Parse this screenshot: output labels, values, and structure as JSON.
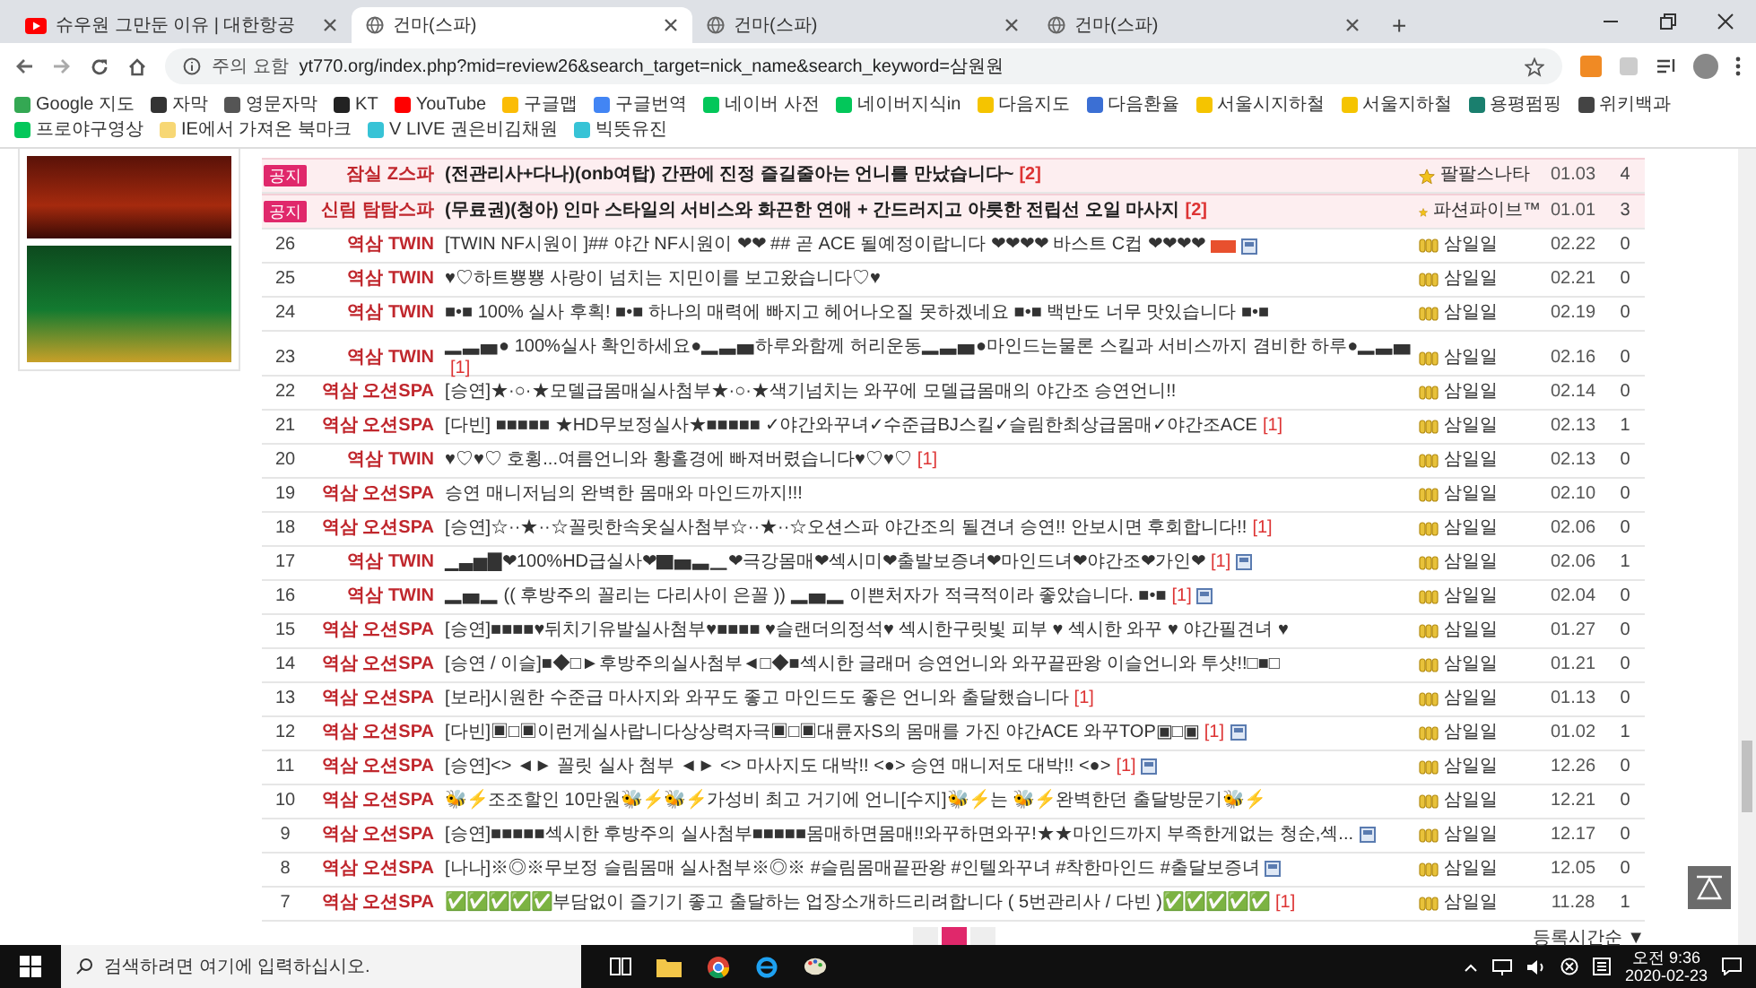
{
  "browser": {
    "tabs": [
      {
        "title": "슈우원 그만둔 이유 | 대한항공",
        "kind": "video",
        "selected": false
      },
      {
        "title": "건마(스파)",
        "kind": "page",
        "selected": true
      },
      {
        "title": "건마(스파)",
        "kind": "page",
        "selected": false
      },
      {
        "title": "건마(스파)",
        "kind": "page",
        "selected": false
      }
    ],
    "new_tab": "+",
    "security_label": "주의 요함",
    "url": "yt770.org/index.php?mid=review26&search_target=nick_name&search_keyword=삼원원",
    "bookmarks": [
      {
        "label": "Google 지도",
        "color": "#34a853"
      },
      {
        "label": "자막",
        "color": "#333333"
      },
      {
        "label": "영문자막",
        "color": "#555555"
      },
      {
        "label": "KT",
        "color": "#222222"
      },
      {
        "label": "YouTube",
        "color": "#ff0000"
      },
      {
        "label": "구글맵",
        "color": "#fbbc05"
      },
      {
        "label": "구글번역",
        "color": "#4285f4"
      },
      {
        "label": "네이버 사전",
        "color": "#03c75a"
      },
      {
        "label": "네이버지식in",
        "color": "#03c75a"
      },
      {
        "label": "다음지도",
        "color": "#f5c400"
      },
      {
        "label": "다음환율",
        "color": "#3b6fd4"
      },
      {
        "label": "서울시지하철",
        "color": "#f5c400"
      },
      {
        "label": "서울지하철",
        "color": "#f5c400"
      },
      {
        "label": "용평펌핑",
        "color": "#1a7f6e"
      },
      {
        "label": "위키백과",
        "color": "#444444"
      },
      {
        "label": "프로야구영상",
        "color": "#03c75a"
      },
      {
        "label": "IE에서 가져온 북마크",
        "color": "#f7d774"
      },
      {
        "label": "V LIVE 권은비김채원",
        "color": "#37c3d6"
      },
      {
        "label": "빅뜻유진",
        "color": "#37c3d6"
      }
    ]
  },
  "board": {
    "rows": [
      {
        "kind": "notice",
        "badge": "공지",
        "category": "잠실 Z스파",
        "title": "(전관리사+다나)(onb여탑) 간판에 진정 즐길줄아는 언니를 만났습니다~",
        "comments": "[2]",
        "new": false,
        "file": false,
        "author": "팔팔스나타",
        "date": "01.03",
        "views": "4"
      },
      {
        "kind": "notice",
        "badge": "공지",
        "category": "신림 탐탐스파",
        "title": "(무료권)(청아) 인마 스타일의 서비스와 화끈한 연애 + 간드러지고 아릇한 전립선 오일 마사지",
        "comments": "[2]",
        "new": false,
        "file": false,
        "author": "파션파이브™",
        "date": "01.01",
        "views": "3"
      },
      {
        "kind": "post",
        "number": "26",
        "category": "역삼 TWIN",
        "title": "[TWIN NF시원이 ]## 야간 NF시원이 ❤❤ ## 곧 ACE 될예정이랍니다 ❤❤❤❤ 바스트 C컵 ❤❤❤❤",
        "new": true,
        "file": true,
        "author": "삼일일",
        "date": "02.22",
        "views": "0"
      },
      {
        "kind": "post",
        "number": "25",
        "category": "역삼 TWIN",
        "title": "♥♡하트뿅뿅 사랑이 넘치는 지민이를 보고왔습니다♡♥",
        "new": false,
        "file": false,
        "author": "삼일일",
        "date": "02.21",
        "views": "0"
      },
      {
        "kind": "post",
        "number": "24",
        "category": "역삼 TWIN",
        "title": "■•■ 100% 실사 후획! ■•■ 하나의 매력에 빠지고 헤어나오질 못하겠네요 ■•■ 백반도 너무 맛있습니다 ■•■",
        "new": false,
        "file": false,
        "author": "삼일일",
        "date": "02.19",
        "views": "0"
      },
      {
        "kind": "post",
        "number": "23",
        "category": "역삼 TWIN",
        "title": "▂▃▅● 100%실사 확인하세요●▂▃▅하루와함께 허리운동▂▃▅●마인드는물론 스킬과 서비스까지 겸비한 하루●▂▃▅",
        "comments": "[1]",
        "new": false,
        "file": false,
        "author": "삼일일",
        "date": "02.16",
        "views": "0"
      },
      {
        "kind": "post",
        "number": "22",
        "category": "역삼 오션SPA",
        "title": "[승연]★·○·★모델급몸매실사첨부★·○·★색기넘치는 와꾸에 모델급몸매의 야간조 승연언니!!",
        "new": false,
        "file": false,
        "author": "삼일일",
        "date": "02.14",
        "views": "0"
      },
      {
        "kind": "post",
        "number": "21",
        "category": "역삼 오션SPA",
        "title": "[다빈] ■■■■■ ★HD무보정실사★■■■■■ ✓야간와꾸녀✓수준급BJ스킬✓슬림한최상급몸매✓야간조ACE",
        "comments": "[1]",
        "new": false,
        "file": false,
        "author": "삼일일",
        "date": "02.13",
        "views": "1"
      },
      {
        "kind": "post",
        "number": "20",
        "category": "역삼 TWIN",
        "title": "♥♡♥♡ 호횡...여름언니와 황홀경에 빠져버렸습니다♥♡♥♡",
        "comments": "[1]",
        "new": false,
        "file": false,
        "author": "삼일일",
        "date": "02.13",
        "views": "0"
      },
      {
        "kind": "post",
        "number": "19",
        "category": "역삼 오션SPA",
        "title": "승연 매니저님의 완벽한 몸매와 마인드까지!!!",
        "new": false,
        "file": false,
        "author": "삼일일",
        "date": "02.10",
        "views": "0"
      },
      {
        "kind": "post",
        "number": "18",
        "category": "역삼 오션SPA",
        "title": "[승연]☆··★··☆꼴릿한속옷실사첨부☆··★··☆오션스파 야간조의 될견녀 승연!! 안보시면 후회합니다!!",
        "comments": "[1]",
        "new": false,
        "file": false,
        "author": "삼일일",
        "date": "02.06",
        "views": "0"
      },
      {
        "kind": "post",
        "number": "17",
        "category": "역삼 TWIN",
        "title": "▁▃▅▇❤100%HD급실사❤▇▅▃▁❤극강몸매❤섹시미❤출발보증녀❤마인드녀❤야간조❤가인❤",
        "comments": "[1]",
        "new": false,
        "file": true,
        "author": "삼일일",
        "date": "02.06",
        "views": "1"
      },
      {
        "kind": "post",
        "number": "16",
        "category": "역삼 TWIN",
        "title": "▂▅▂ (( 후방주의 꼴리는 다리사이 은꼴 )) ▂▅▂ 이쁜처자가 적극적이라 좋았습니다. ■•■",
        "comments": "[1]",
        "new": false,
        "file": true,
        "author": "삼일일",
        "date": "02.04",
        "views": "0"
      },
      {
        "kind": "post",
        "number": "15",
        "category": "역삼 오션SPA",
        "title": "[승연]■■■■♥뒤치기유발실사첨부♥■■■■ ♥슬랜더의정석♥ 섹시한구릿빛 피부 ♥ 섹시한 와꾸 ♥ 야간필견녀 ♥",
        "new": false,
        "file": false,
        "author": "삼일일",
        "date": "01.27",
        "views": "0"
      },
      {
        "kind": "post",
        "number": "14",
        "category": "역삼 오션SPA",
        "title": "[승연 / 이슬]■◆□►후방주의실사첨부◄□◆■섹시한 글래머 승연언니와 와꾸끝판왕 이슬언니와 투샷!!□■□",
        "new": false,
        "file": false,
        "author": "삼일일",
        "date": "01.21",
        "views": "0"
      },
      {
        "kind": "post",
        "number": "13",
        "category": "역삼 오션SPA",
        "title": "[보라]시원한 수준급 마사지와 와꾸도 좋고 마인드도 좋은 언니와 출달했습니다",
        "comments": "[1]",
        "new": false,
        "file": false,
        "author": "삼일일",
        "date": "01.13",
        "views": "0"
      },
      {
        "kind": "post",
        "number": "12",
        "category": "역삼 오션SPA",
        "title": "[다빈]▣□▣이런게실사랍니다상상력자극▣□▣대륜자S의 몸매를 가진 야간ACE 와꾸TOP▣□▣",
        "comments": "[1]",
        "new": false,
        "file": true,
        "author": "삼일일",
        "date": "01.02",
        "views": "1"
      },
      {
        "kind": "post",
        "number": "11",
        "category": "역삼 오션SPA",
        "title": "[승연]<> ◄► 꼴릿 실사 첨부 ◄► <> 마사지도 대박!! <●> 승연 매니저도 대박!! <●>",
        "comments": "[1]",
        "new": false,
        "file": true,
        "author": "삼일일",
        "date": "12.26",
        "views": "0"
      },
      {
        "kind": "post",
        "number": "10",
        "category": "역삼 오션SPA",
        "title": "🐝⚡조조할인 10만원🐝⚡🐝⚡가성비 최고 거기에 언니[수지]🐝⚡는 🐝⚡완벽한던 출달방문기🐝⚡",
        "new": false,
        "file": false,
        "author": "삼일일",
        "date": "12.21",
        "views": "0"
      },
      {
        "kind": "post",
        "number": "9",
        "category": "역삼 오션SPA",
        "title": "[승연]■■■■■섹시한 후방주의 실사첨부■■■■■몸매하면몸매!!와꾸하면와꾸!★★마인드까지 부족한게없는 청순,섹...",
        "new": false,
        "file": true,
        "author": "삼일일",
        "date": "12.17",
        "views": "0"
      },
      {
        "kind": "post",
        "number": "8",
        "category": "역삼 오션SPA",
        "title": "[나나]※◎※무보정 슬림몸매 실사첨부※◎※ #슬림몸매끝판왕 #인텔와꾸녀 #착한마인드 #출달보증녀",
        "new": false,
        "file": true,
        "author": "삼일일",
        "date": "12.05",
        "views": "0"
      },
      {
        "kind": "post",
        "number": "7",
        "category": "역삼 오션SPA",
        "title": "✅✅✅✅✅부담없이 즐기기 좋고 출달하는 업장소개하드리려합니다 ( 5번관리사 / 다빈 )✅✅✅✅✅",
        "comments": "[1]",
        "new": false,
        "file": false,
        "author": "삼일일",
        "date": "11.28",
        "views": "1"
      }
    ],
    "pages": [
      {
        "selected": false
      },
      {
        "selected": true
      },
      {
        "selected": false
      }
    ],
    "sort": "등록시간순 ▼"
  },
  "taskbar": {
    "search_placeholder": "검색하려면 여기에 입력하십시오.",
    "time": "오전 9:36",
    "date": "2020-02-23"
  }
}
